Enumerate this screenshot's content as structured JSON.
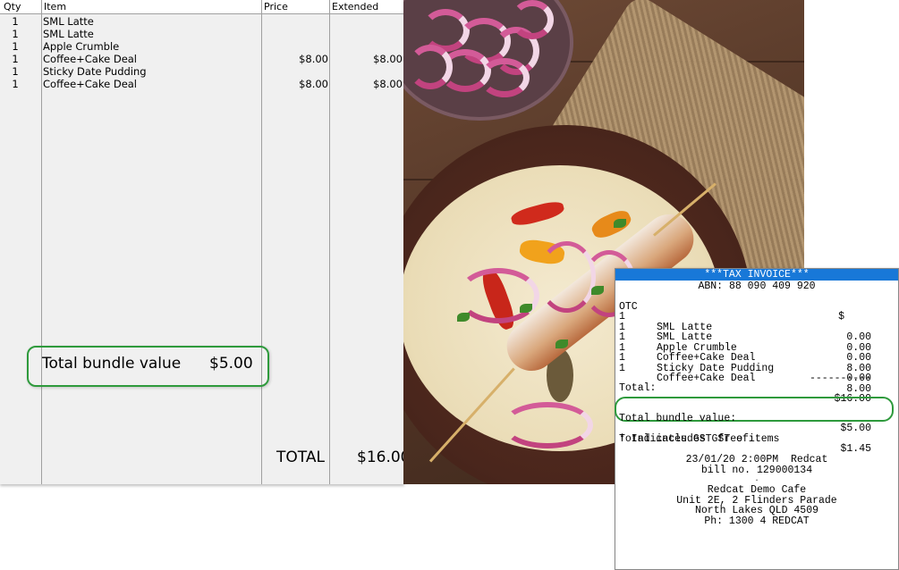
{
  "pos_grid": {
    "columns": [
      "Qty",
      "Item",
      "Price",
      "Extended"
    ],
    "rows": [
      {
        "qty": "1",
        "item": "SML Latte",
        "price": "",
        "extended": ""
      },
      {
        "qty": "1",
        "item": "SML Latte",
        "price": "",
        "extended": ""
      },
      {
        "qty": "1",
        "item": "Apple Crumble",
        "price": "",
        "extended": ""
      },
      {
        "qty": "1",
        "item": "Coffee+Cake Deal",
        "price": "$8.00",
        "extended": "$8.00"
      },
      {
        "qty": "1",
        "item": "Sticky Date Pudding",
        "price": "",
        "extended": ""
      },
      {
        "qty": "1",
        "item": "Coffee+Cake Deal",
        "price": "$8.00",
        "extended": "$8.00"
      }
    ],
    "bundle_label": "Total bundle value",
    "bundle_value": "$5.00",
    "total_label": "TOTAL",
    "total_value": "$16.00"
  },
  "photo": {
    "subject": "chicken-fajita-wrap-photo"
  },
  "receipt": {
    "title": "***TAX INVOICE***",
    "abn": "ABN: 88 090 409 920",
    "header_left": "OTC",
    "header_right": "$",
    "lines": [
      {
        "qty": "1",
        "item": "SML Latte",
        "amount": "0.00"
      },
      {
        "qty": "1",
        "item": "SML Latte",
        "amount": "0.00"
      },
      {
        "qty": "1",
        "item": "Apple Crumble",
        "amount": "0.00"
      },
      {
        "qty": "1",
        "item": "Coffee+Cake Deal",
        "amount": "8.00"
      },
      {
        "qty": "1",
        "item": "Sticky Date Pudding",
        "amount": "0.00"
      },
      {
        "qty": "1",
        "item": "Coffee+Cake Deal",
        "amount": "8.00"
      }
    ],
    "separator": "----------",
    "total_label": "Total:",
    "total_value": "$16.00",
    "bundle_label": "Total bundle value:",
    "bundle_value": "$5.00",
    "gst_label": "Total includes GST of:",
    "gst_value": "$1.45",
    "gst_note": "* Indicates GST free items",
    "datetime_line": "23/01/20 2:00PM  Redcat",
    "bill_line": "bill no. 129000134",
    "dot": ".",
    "store_name": "Redcat Demo Cafe",
    "address1": "Unit 2E, 2 Flinders Parade",
    "address2": "North Lakes QLD 4509",
    "phone": "Ph: 1300 4 REDCAT"
  },
  "colors": {
    "highlight_green": "#2e9a3c",
    "receipt_title_bg": "#1878d8",
    "grid_bg": "#f0f0f0"
  }
}
